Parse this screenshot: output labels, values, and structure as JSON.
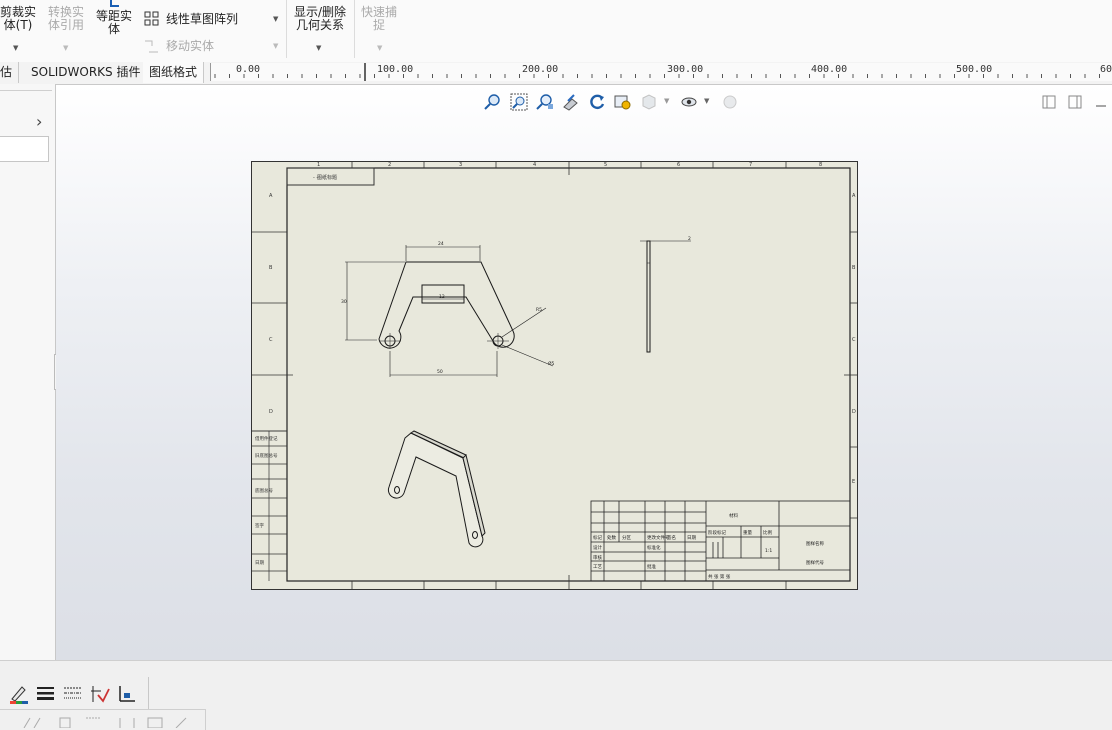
{
  "ribbon": {
    "trim_entities": "剪裁实体(T)",
    "convert_entities": "转换实体引用",
    "offset_entities": "等距实体",
    "linear_pattern": "线性草图阵列",
    "move_entities": "移动实体",
    "display_delete_relations": "显示/删除几何关系",
    "rapid_snaps": "快速捕捉"
  },
  "tabs": {
    "partial_left": "估",
    "solidworks_addins": "SOLIDWORKS 插件",
    "sheet_format": "图纸格式"
  },
  "ruler": {
    "labels": [
      "0.00",
      "100.00",
      "200.00",
      "300.00",
      "400.00",
      "500.00",
      "60"
    ]
  },
  "drawing": {
    "header_label": "图纸标题",
    "title_block": {
      "design": "设计",
      "check": "审核",
      "process": "工艺",
      "approve": "批准",
      "marker": "标记",
      "count": "处数",
      "zone": "分区",
      "doc_no": "更改文件号",
      "sign": "签名",
      "date": "日期",
      "stage_mark": "阶段标记",
      "weight": "重量",
      "scale": "比例",
      "material": "材料",
      "drawing_name": "图样名称",
      "drawing_no": "图样代号",
      "sheet": "共 张 第 张"
    },
    "left_strip": [
      "借用件登记",
      "旧底图总号",
      "底图总号",
      "签字",
      "日期"
    ],
    "dims": {
      "top_width": "24",
      "inner_width": "12",
      "height": "30",
      "bottom_width": "50",
      "radius": "R5",
      "hole": "Ø5"
    }
  },
  "bottom_toolbar": {
    "icons": [
      "line-color-icon",
      "line-thickness-icon",
      "line-style-icon",
      "hide-show-edges-icon",
      "color-display-mode-icon"
    ]
  }
}
